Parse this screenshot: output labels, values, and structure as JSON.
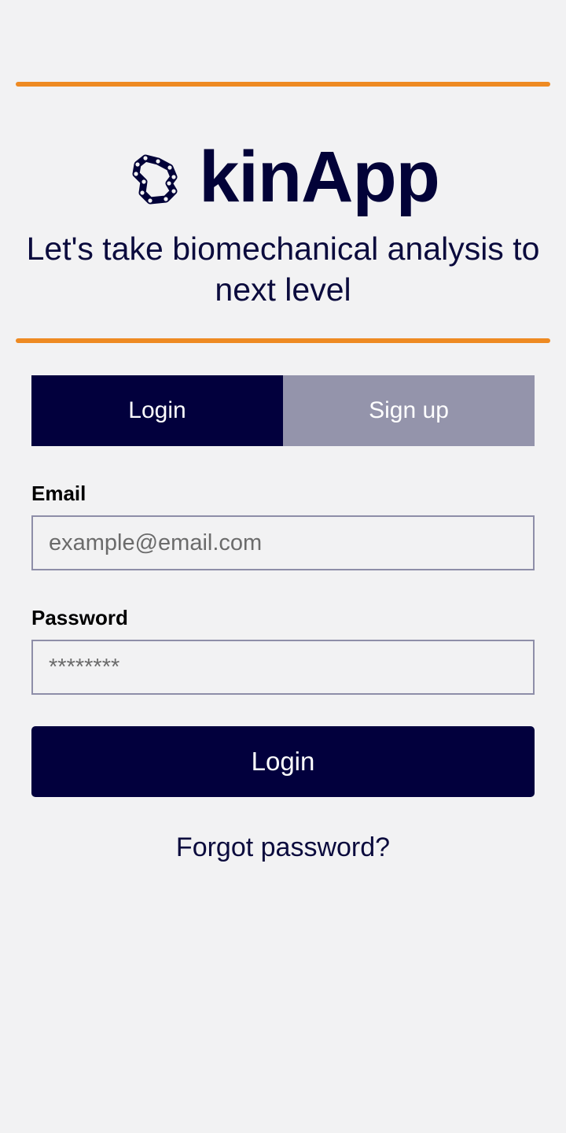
{
  "colors": {
    "background": "#f2f2f3",
    "accent_orange": "#ee8a22",
    "primary_navy": "#02003d",
    "inactive_tab": "#9494ab",
    "input_border": "#8e8ea8"
  },
  "brand": {
    "logo_icon": "kinematic-chain-logo-icon",
    "name": "kinApp",
    "tagline": "Let's take biomechanical analysis to next level"
  },
  "tabs": [
    {
      "label": "Login",
      "active": true
    },
    {
      "label": "Sign up",
      "active": false
    }
  ],
  "form": {
    "email": {
      "label": "Email",
      "value": "",
      "placeholder": "example@email.com"
    },
    "password": {
      "label": "Password",
      "value": "",
      "placeholder": "********"
    },
    "submit_label": "Login",
    "forgot_label": "Forgot password?"
  }
}
